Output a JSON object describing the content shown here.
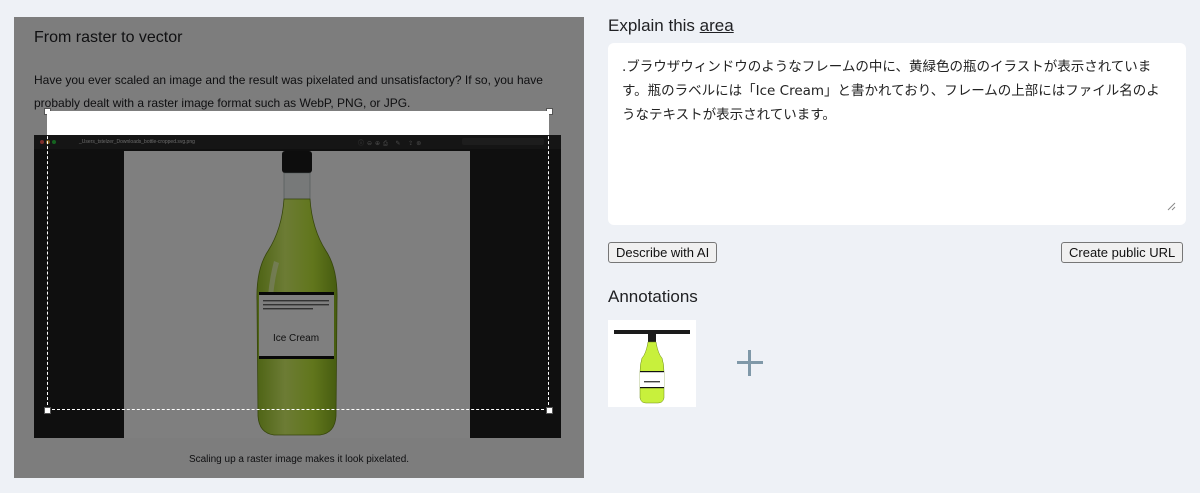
{
  "article": {
    "title": "From raster to vector",
    "paragraph": "Have you ever scaled an image and the result was pixelated and unsatisfactory? If so, you have probably dealt with a raster image format such as WebP, PNG, or JPG.",
    "caption": "Scaling up a raster image makes it look pixelated.",
    "embedded_filename": "_Users_tstelzer_Downloads_bottle-cropped.svg.png",
    "bottle_label": "Ice Cream"
  },
  "explain": {
    "heading_prefix": "Explain this ",
    "heading_link": "area",
    "text": ".ブラウザウィンドウのようなフレームの中に、黄緑色の瓶のイラストが表示されています。瓶のラベルには「Ice Cream」と書かれており、フレームの上部にはファイル名のようなテキストが表示されています。"
  },
  "buttons": {
    "describe": "Describe with AI",
    "public_url": "Create public URL"
  },
  "annotations": {
    "heading": "Annotations",
    "add_icon": "plus-icon"
  },
  "colors": {
    "liquid": "#c8f03c",
    "overlay": "rgba(0,0,0,0.5)",
    "add_icon": "#7f98a8"
  }
}
